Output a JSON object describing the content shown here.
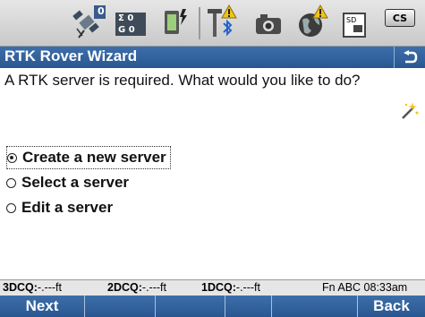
{
  "statusbar": {
    "sats_count": "0",
    "sigma_top": "0",
    "sigma_bottom": "0",
    "sd_label": "SD",
    "cs_label": "CS"
  },
  "title": "RTK Rover Wizard",
  "question": "A RTK server is required. What would you like to do?",
  "options": [
    {
      "label": "Create a new server",
      "selected": true
    },
    {
      "label": "Select a server",
      "selected": false
    },
    {
      "label": "Edit a server",
      "selected": false
    }
  ],
  "status": {
    "dcq3_label": "3DCQ:",
    "dcq3_value": "-.---ft",
    "dcq2_label": "2DCQ:",
    "dcq2_value": "-.---ft",
    "dcq1_label": "1DCQ:",
    "dcq1_value": "-.---ft",
    "right": "Fn  ABC 08:33am"
  },
  "softkeys": [
    "Next",
    "",
    "",
    "",
    "",
    "Back"
  ],
  "colors": {
    "bar_blue": "#2f5e9b",
    "warning": "#f0c419"
  }
}
